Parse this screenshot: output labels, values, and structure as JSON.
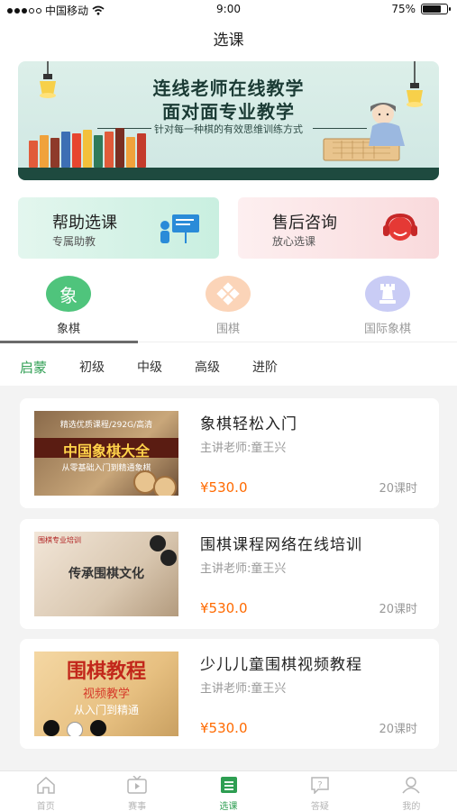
{
  "status_bar": {
    "carrier": "中国移动",
    "time": "9:00",
    "battery": "75%",
    "battery_level": 0.75
  },
  "header": {
    "title": "选课"
  },
  "banner": {
    "line1": "连线老师在线教学",
    "line2": "面对面专业教学",
    "line3": "针对每一种棋的有效思维训练方式"
  },
  "services": [
    {
      "title": "帮助选课",
      "subtitle": "专属助教",
      "icon": "presentation-icon"
    },
    {
      "title": "售后咨询",
      "subtitle": "放心选课",
      "icon": "headset-icon"
    }
  ],
  "categories": [
    {
      "label": "象棋",
      "glyph": "象",
      "color": "#3dbb6e",
      "bg": "#4fc47c",
      "active": true
    },
    {
      "label": "围棋",
      "glyph": "",
      "color": "#f5a66a",
      "bg": "#fbd4b8",
      "active": false
    },
    {
      "label": "国际象棋",
      "glyph": "",
      "color": "#7e86e6",
      "bg": "#c9ccf5",
      "active": false
    }
  ],
  "levels": [
    "启蒙",
    "初级",
    "中级",
    "高级",
    "进阶"
  ],
  "courses": [
    {
      "name": "象棋轻松入门",
      "teacher": "主讲老师:童王兴",
      "price": "¥530.0",
      "hours": "20课时",
      "thumb_line1": "精选优质课程/292G/高清",
      "thumb_line2": "中国象棋大全",
      "thumb_line3": "从零基础入门到精通象棋"
    },
    {
      "name": "围棋课程网络在线培训",
      "teacher": "主讲老师:童王兴",
      "price": "¥530.0",
      "hours": "20课时",
      "thumb_line1": "围棋专业培训",
      "thumb_line2": "传承围棋文化"
    },
    {
      "name": "少儿儿童围棋视频教程",
      "teacher": "主讲老师:童王兴",
      "price": "¥530.0",
      "hours": "20课时",
      "thumb_line1": "围棋教程",
      "thumb_line2": "视频教学",
      "thumb_line3": "从入门到精通"
    }
  ],
  "bottom_nav": [
    {
      "label": "首页",
      "icon": "home-icon"
    },
    {
      "label": "赛事",
      "icon": "tv-icon"
    },
    {
      "label": "选课",
      "icon": "list-icon",
      "active": true
    },
    {
      "label": "答疑",
      "icon": "question-icon"
    },
    {
      "label": "我的",
      "icon": "person-icon"
    }
  ],
  "colors": {
    "accent": "#2e9e52",
    "price": "#ff6a00"
  }
}
